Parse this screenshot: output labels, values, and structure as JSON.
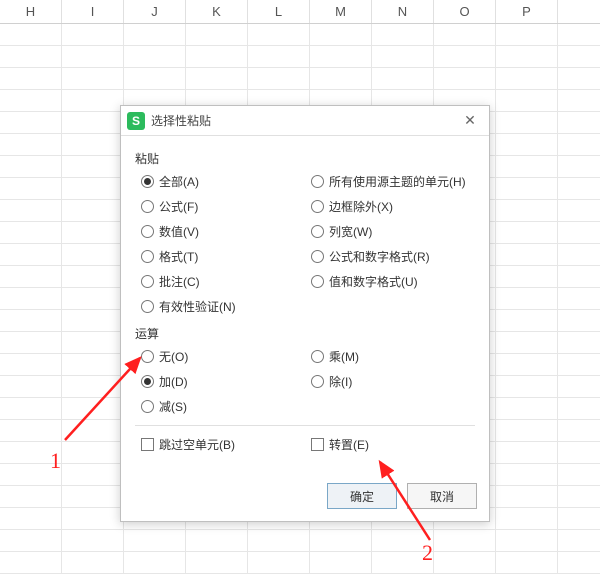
{
  "columns": [
    "H",
    "I",
    "J",
    "K",
    "L",
    "M",
    "N",
    "O",
    "P"
  ],
  "dialog": {
    "app_icon_letter": "S",
    "title": "选择性粘贴",
    "sections": {
      "paste": {
        "label": "粘贴",
        "options": {
          "all": "全部(A)",
          "formulas": "公式(F)",
          "values": "数值(V)",
          "formats": "格式(T)",
          "comments": "批注(C)",
          "validation": "有效性验证(N)",
          "all_source_theme": "所有使用源主题的单元(H)",
          "except_borders": "边框除外(X)",
          "col_widths": "列宽(W)",
          "formulas_num_fmt": "公式和数字格式(R)",
          "values_num_fmt": "值和数字格式(U)"
        },
        "selected": "all"
      },
      "operation": {
        "label": "运算",
        "options": {
          "none": "无(O)",
          "add": "加(D)",
          "subtract": "减(S)",
          "multiply": "乘(M)",
          "divide": "除(I)"
        },
        "selected": "add"
      },
      "checks": {
        "skip_blanks": "跳过空单元(B)",
        "transpose": "转置(E)"
      }
    },
    "buttons": {
      "ok": "确定",
      "cancel": "取消"
    }
  },
  "annotations": {
    "label1": "1",
    "label2": "2"
  }
}
